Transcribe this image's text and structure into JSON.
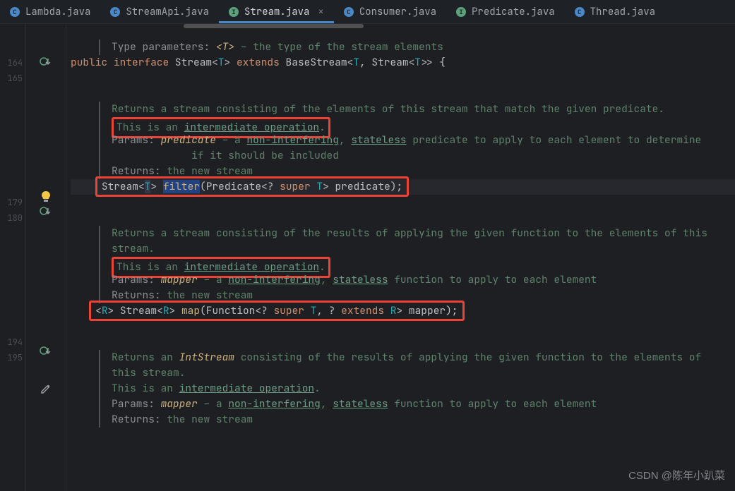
{
  "tabs": [
    {
      "icon": "C",
      "iconClass": "ic-c",
      "label": "Lambda.java"
    },
    {
      "icon": "C",
      "iconClass": "ic-c",
      "label": "StreamApi.java"
    },
    {
      "icon": "I",
      "iconClass": "ic-i",
      "label": "Stream.java",
      "active": true
    },
    {
      "icon": "C",
      "iconClass": "ic-c",
      "label": "Consumer.java"
    },
    {
      "icon": "I",
      "iconClass": "ic-i",
      "label": "Predicate.java"
    },
    {
      "icon": "C",
      "iconClass": "ic-c",
      "label": "Thread.java"
    }
  ],
  "lineNumbers": {
    "l164": "164",
    "l165": "165",
    "l179": "179",
    "l180": "180",
    "l194": "194",
    "l195": "195"
  },
  "doc1": {
    "typeParamsLabel": "Type parameters: ",
    "tp": "<T>",
    "tpDesc": " – the type of the stream elements"
  },
  "sig": {
    "public": "public",
    "interface": "interface",
    "Stream": "Stream",
    "T": "T",
    "extends": "extends",
    "BaseStream": "BaseStream",
    "open": "<",
    "close": ">",
    "comma": ", ",
    "gt2": ">>",
    "brace": " {"
  },
  "filterDoc": {
    "line1": "Returns a stream consisting of the elements of this stream that match the given predicate.",
    "intermPrefix": "This is an ",
    "intermLink": "intermediate operation",
    "intermDot": ".",
    "paramsLabel": "Params: ",
    "paramName": "predicate",
    "paramDash": " – a ",
    "nonInterfering": "non-interfering",
    "comma": ", ",
    "stateless": "stateless",
    "paramTail": " predicate to apply to each element to determine",
    "paramTail2": "if it should be included",
    "returnsLabel": "Returns: ",
    "returnsVal": "the new stream"
  },
  "filterSig": {
    "Stream": "Stream",
    "T": "T",
    "filter": "filter",
    "open": "(",
    "Predicate": "Predicate",
    "lt": "<",
    "q": "? ",
    "super": "super",
    "sp": " ",
    "gt": ">",
    "param": " predicate",
    "close": ");"
  },
  "mapDoc": {
    "line1": "Returns a stream consisting of the results of applying the given function to the elements of this",
    "line1b": "stream.",
    "intermPrefix": "This is an ",
    "intermLink": "intermediate operation",
    "intermDot": ".",
    "paramsLabel": "Params: ",
    "paramName": "mapper",
    "paramDash": " – a ",
    "nonInterfering": "non-interfering",
    "comma": ", ",
    "stateless": "stateless",
    "paramTail": " function to apply to each element",
    "returnsLabel": "Returns: ",
    "returnsVal": "the new stream"
  },
  "mapSig": {
    "lt": "<",
    "R": "R",
    "gt": "> ",
    "Stream": "Stream",
    "map": "map",
    "open": "(",
    "Function": "Function",
    "q": "? ",
    "super": "super",
    "sp": " ",
    "T": "T",
    "comma": ", ",
    "q2": "? ",
    "extends": "extends",
    "param": " mapper",
    "close": ");"
  },
  "intDoc": {
    "line1a": "Returns an ",
    "IntStream": "IntStream",
    "line1b": " consisting of the results of applying the given function to the elements of",
    "line2": "this stream.",
    "intermPrefix": "This is an ",
    "intermLink": "intermediate operation",
    "intermDot": ".",
    "paramsLabel": "Params: ",
    "paramName": "mapper",
    "paramDash": " – a ",
    "nonInterfering": "non-interfering",
    "comma": ", ",
    "stateless": "stateless",
    "paramTail": " function to apply to each element",
    "returnsLabel": "Returns: ",
    "returnsVal": "the new stream"
  },
  "watermark": "CSDN @陈年小趴菜"
}
